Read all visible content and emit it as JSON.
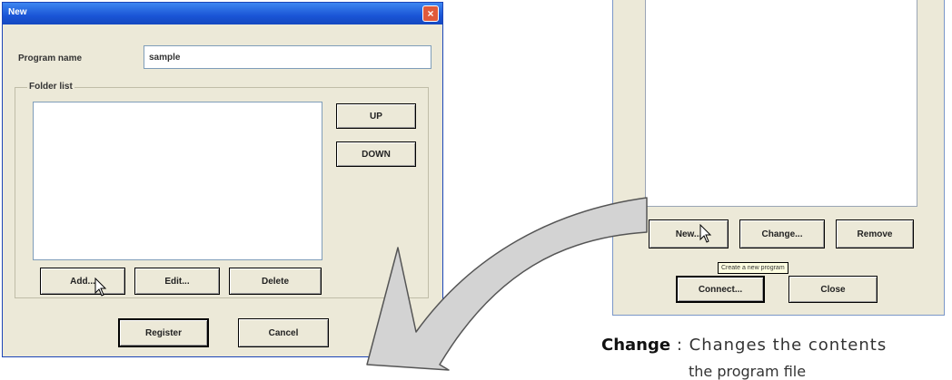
{
  "new_dialog": {
    "title": "New",
    "close_glyph": "×",
    "program_name_label": "Program name",
    "program_name_value": "sample",
    "folder_list_label": "Folder list",
    "up_label": "UP",
    "down_label": "DOWN",
    "add_label": "Add...",
    "edit_label": "Edit...",
    "delete_label": "Delete",
    "register_label": "Register",
    "cancel_label": "Cancel"
  },
  "program_dialog": {
    "new_label": "New...",
    "change_label": "Change...",
    "remove_label": "Remove",
    "tooltip": "Create a new program",
    "connect_label": "Connect...",
    "close_label": "Close"
  },
  "caption": {
    "term": "Change",
    "separator": ":",
    "text": "Changes the contents",
    "continuation": "the program file"
  },
  "icons": {
    "cursor": "mouse-pointer-icon",
    "arrow": "curved-arrow-icon",
    "close": "close-icon"
  },
  "colors": {
    "dialog_bg": "#ece9d8",
    "title_bar": "#1a55d6",
    "close_button": "#e05a3a",
    "arrow_fill": "#d3d3d3"
  }
}
